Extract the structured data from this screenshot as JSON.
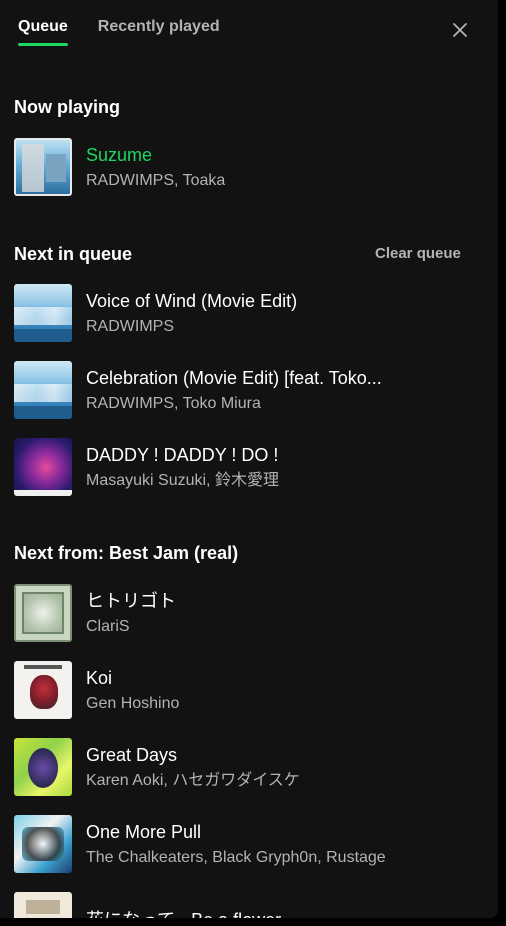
{
  "tabs": [
    {
      "label": "Queue",
      "active": true
    },
    {
      "label": "Recently played",
      "active": false
    }
  ],
  "icons": {
    "close": "close-icon"
  },
  "accent_color": "#1ed760",
  "now_playing": {
    "heading": "Now playing",
    "track": {
      "title": "Suzume",
      "artist": "RADWIMPS, Toaka",
      "art": "album-art"
    }
  },
  "next_in_queue": {
    "heading": "Next in queue",
    "clear_label": "Clear queue",
    "tracks": [
      {
        "title": "Voice of Wind (Movie Edit)",
        "artist": "RADWIMPS"
      },
      {
        "title": "Celebration (Movie Edit) [feat. Toko...",
        "artist": "RADWIMPS, Toko Miura"
      },
      {
        "title": "DADDY ! DADDY ! DO !",
        "artist": "Masayuki Suzuki, 鈴木愛理"
      }
    ]
  },
  "next_from": {
    "heading": "Next from: Best Jam (real)",
    "tracks": [
      {
        "title": "ヒトリゴト",
        "artist": "ClariS"
      },
      {
        "title": "Koi",
        "artist": "Gen Hoshino"
      },
      {
        "title": "Great Days",
        "artist": "Karen Aoki, ハセガワダイスケ"
      },
      {
        "title": "One More Pull",
        "artist": "The Chalkeaters, Black Gryph0n, Rustage"
      },
      {
        "title": "花になって - Be a flower",
        "artist": ""
      }
    ]
  }
}
